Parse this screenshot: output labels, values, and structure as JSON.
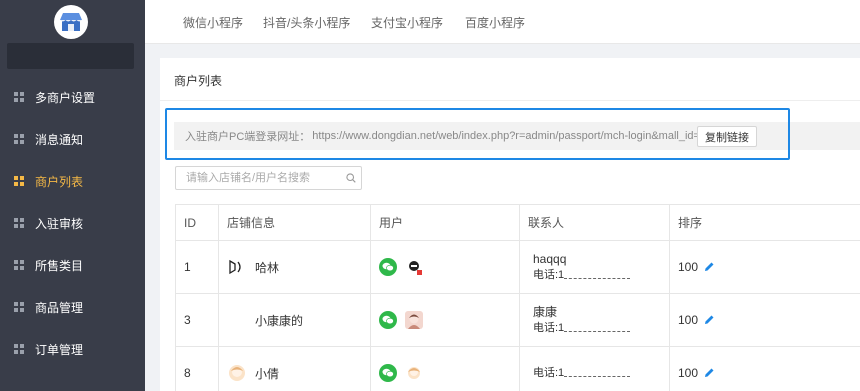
{
  "sidebar": {
    "items": [
      {
        "label": "多商户设置",
        "active": false
      },
      {
        "label": "消息通知",
        "active": false
      },
      {
        "label": "商户列表",
        "active": true
      },
      {
        "label": "入驻审核",
        "active": false
      },
      {
        "label": "所售类目",
        "active": false
      },
      {
        "label": "商品管理",
        "active": false
      },
      {
        "label": "订单管理",
        "active": false
      }
    ]
  },
  "tabs": [
    "微信小程序",
    "抖音/头条小程序",
    "支付宝小程序",
    "百度小程序"
  ],
  "panel": {
    "title": "商户列表",
    "url_label": "入驻商户PC端登录网址：",
    "url_value": "https://www.dongdian.net/web/index.php?r=admin/passport/mch-login&mall_id=MQ",
    "copy_button": "复制链接",
    "search_placeholder": "请输入店铺名/用户名搜索"
  },
  "table": {
    "headers": {
      "id": "ID",
      "store": "店铺信息",
      "user": "用户",
      "contact": "联系人",
      "sort": "排序"
    },
    "rows": [
      {
        "id": "1",
        "store": "哈林",
        "contact_name": "haqqq",
        "phone_label": "电话:1",
        "sort": "100"
      },
      {
        "id": "3",
        "store": "小康康的",
        "contact_name": "康康",
        "phone_label": "电话:1",
        "sort": "100"
      },
      {
        "id": "8",
        "store": "小倩",
        "contact_name": "",
        "phone_label": "电话:1",
        "sort": "100"
      }
    ]
  },
  "colors": {
    "sidebar_bg": "#393d49",
    "active": "#f5b946",
    "wechat": "#2fb84a",
    "highlight_frame": "#1e88e5",
    "edit_icon": "#1e88e5"
  },
  "icons": [
    "store-logo-icon",
    "grid-icon",
    "search-icon",
    "wechat-icon",
    "edit-icon"
  ]
}
